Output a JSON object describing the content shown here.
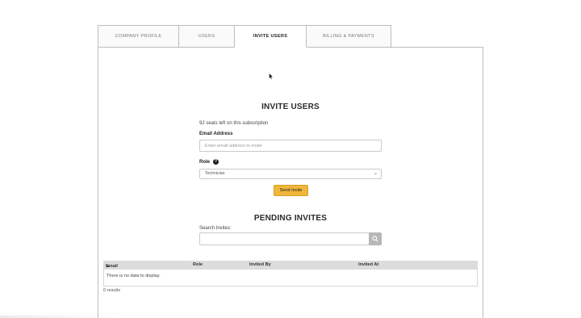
{
  "tabs": [
    {
      "label": "COMPANY PROFILE"
    },
    {
      "label": "USERS"
    },
    {
      "label": "INVITE USERS"
    },
    {
      "label": "BILLING & PAYMENTS"
    }
  ],
  "active_tab": "INVITE USERS",
  "invite": {
    "title": "INVITE USERS",
    "seats_text": "92 seats left on this subscription",
    "email_label": "Email Address",
    "email_placeholder": "Enter email address to invite",
    "email_value": "",
    "role_label": "Role",
    "role_help_icon": "question-circle-icon",
    "role_value": "Technician",
    "send_button": "Send Invite"
  },
  "pending": {
    "title": "PENDING INVITES",
    "search_label": "Search Invites:",
    "search_value": "",
    "search_icon": "magnifier-icon",
    "columns": [
      "Email",
      "Role",
      "Invited By",
      "Invited At"
    ],
    "sort_indicator": "▲",
    "empty_text": "There is no data to display.",
    "results_text": "0 results"
  },
  "colors": {
    "accent_button": "#f0b73a",
    "table_header": "#dcdcdc",
    "search_button": "#b7b7b7"
  }
}
